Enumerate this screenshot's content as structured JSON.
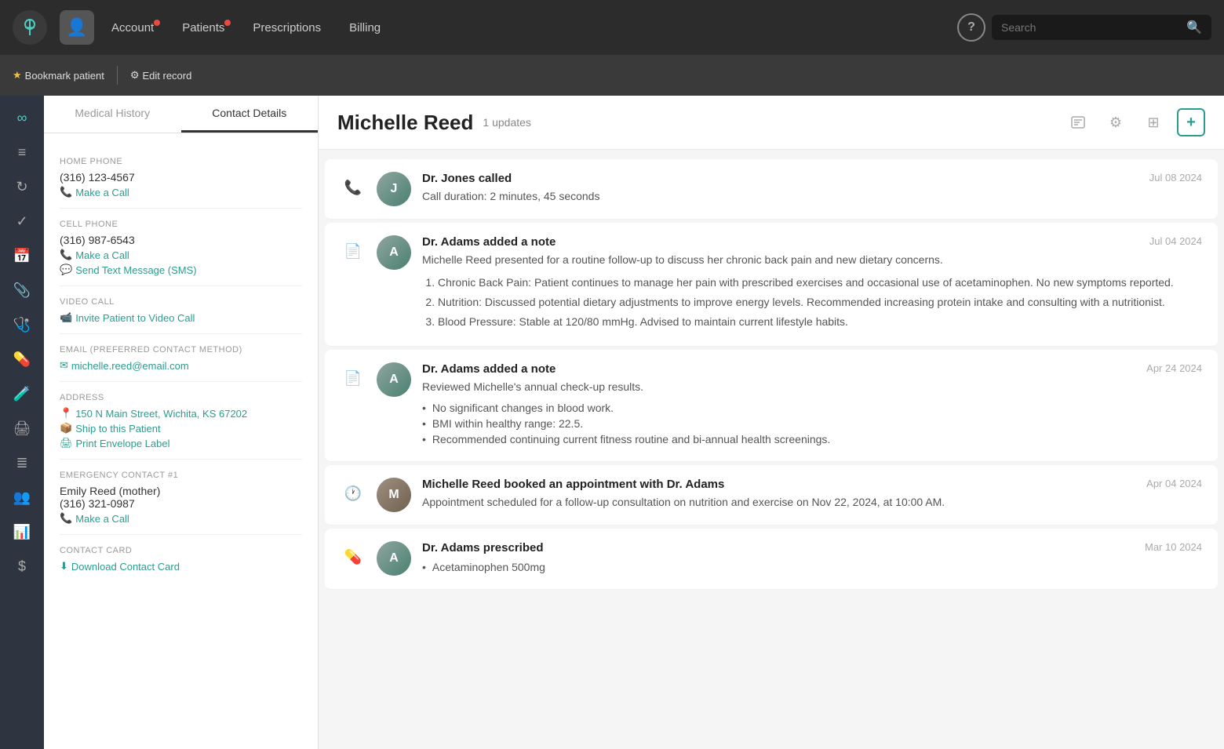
{
  "nav": {
    "items": [
      {
        "label": "Account",
        "hasDot": true
      },
      {
        "label": "Patients",
        "hasDot": true
      },
      {
        "label": "Prescriptions",
        "hasDot": false
      },
      {
        "label": "Billing",
        "hasDot": false
      }
    ],
    "search_placeholder": "Search"
  },
  "patient_bar": {
    "bookmark_label": "Bookmark patient",
    "edit_label": "Edit record"
  },
  "left_panel": {
    "tab_medical": "Medical History",
    "tab_contact": "Contact Details",
    "sections": {
      "home_phone_label": "Home Phone",
      "home_phone_value": "(316) 123-4567",
      "home_phone_call": "Make a Call",
      "cell_phone_label": "Cell Phone",
      "cell_phone_value": "(316) 987-6543",
      "cell_phone_call": "Make a Call",
      "cell_phone_sms": "Send Text Message (SMS)",
      "video_call_label": "Video Call",
      "video_call_link": "Invite Patient to Video Call",
      "email_label": "Email (preferred contact method)",
      "email_value": "michelle.reed@email.com",
      "address_label": "Address",
      "address_value": "150 N Main Street, Wichita, KS 67202",
      "ship_link": "Ship to this Patient",
      "print_link": "Print Envelope Label",
      "emergency_label": "Emergency Contact #1",
      "emergency_name": "Emily Reed (mother)",
      "emergency_phone": "(316) 321-0987",
      "emergency_call": "Make a Call",
      "contact_card_label": "Contact Card",
      "contact_card_link": "Download Contact Card"
    }
  },
  "patient": {
    "name": "Michelle Reed",
    "updates": "1 updates"
  },
  "feed": [
    {
      "id": 1,
      "icon_type": "phone",
      "avatar_type": "doctor",
      "avatar_initials": "J",
      "title": "Dr. Jones called",
      "body": "Call duration: 2 minutes, 45 seconds",
      "date": "Jul 08 2024",
      "type": "call"
    },
    {
      "id": 2,
      "icon_type": "note",
      "avatar_type": "doctor",
      "avatar_initials": "A",
      "title": "Dr. Adams added a note",
      "body": "Michelle Reed presented for a routine follow-up to discuss her chronic back pain and new dietary concerns.",
      "date": "Jul 04 2024",
      "type": "note",
      "list_items": [
        "Chronic Back Pain: Patient continues to manage her pain with prescribed exercises and occasional use of acetaminophen. No new symptoms reported.",
        "Nutrition: Discussed potential dietary adjustments to improve energy levels. Recommended increasing protein intake and consulting with a nutritionist.",
        "Blood Pressure: Stable at 120/80 mmHg. Advised to maintain current lifestyle habits."
      ]
    },
    {
      "id": 3,
      "icon_type": "note",
      "avatar_type": "doctor",
      "avatar_initials": "A",
      "title": "Dr. Adams added a note",
      "body": "Reviewed Michelle's annual check-up results.",
      "date": "Apr 24 2024",
      "type": "note",
      "bullets": [
        "No significant changes in blood work.",
        "BMI within healthy range: 22.5.",
        "Recommended continuing current fitness routine and bi-annual health screenings."
      ]
    },
    {
      "id": 4,
      "icon_type": "clock",
      "avatar_type": "patient",
      "avatar_initials": "M",
      "title": "Michelle Reed booked an appointment with Dr. Adams",
      "body": "Appointment scheduled for a follow-up consultation on nutrition and exercise on Nov 22, 2024, at 10:00 AM.",
      "date": "Apr 04 2024",
      "type": "appointment"
    },
    {
      "id": 5,
      "icon_type": "pill",
      "avatar_type": "doctor",
      "avatar_initials": "A",
      "title": "Dr. Adams prescribed",
      "date": "Mar 10 2024",
      "type": "prescription",
      "bullets": [
        "Acetaminophen 500mg"
      ]
    }
  ],
  "sidebar_icons": [
    "∞",
    "≡",
    "⟳",
    "✓",
    "📅",
    "📎",
    "♡",
    "💊",
    "🧪",
    "🖨",
    "≣",
    "👥",
    "📊",
    "$"
  ]
}
